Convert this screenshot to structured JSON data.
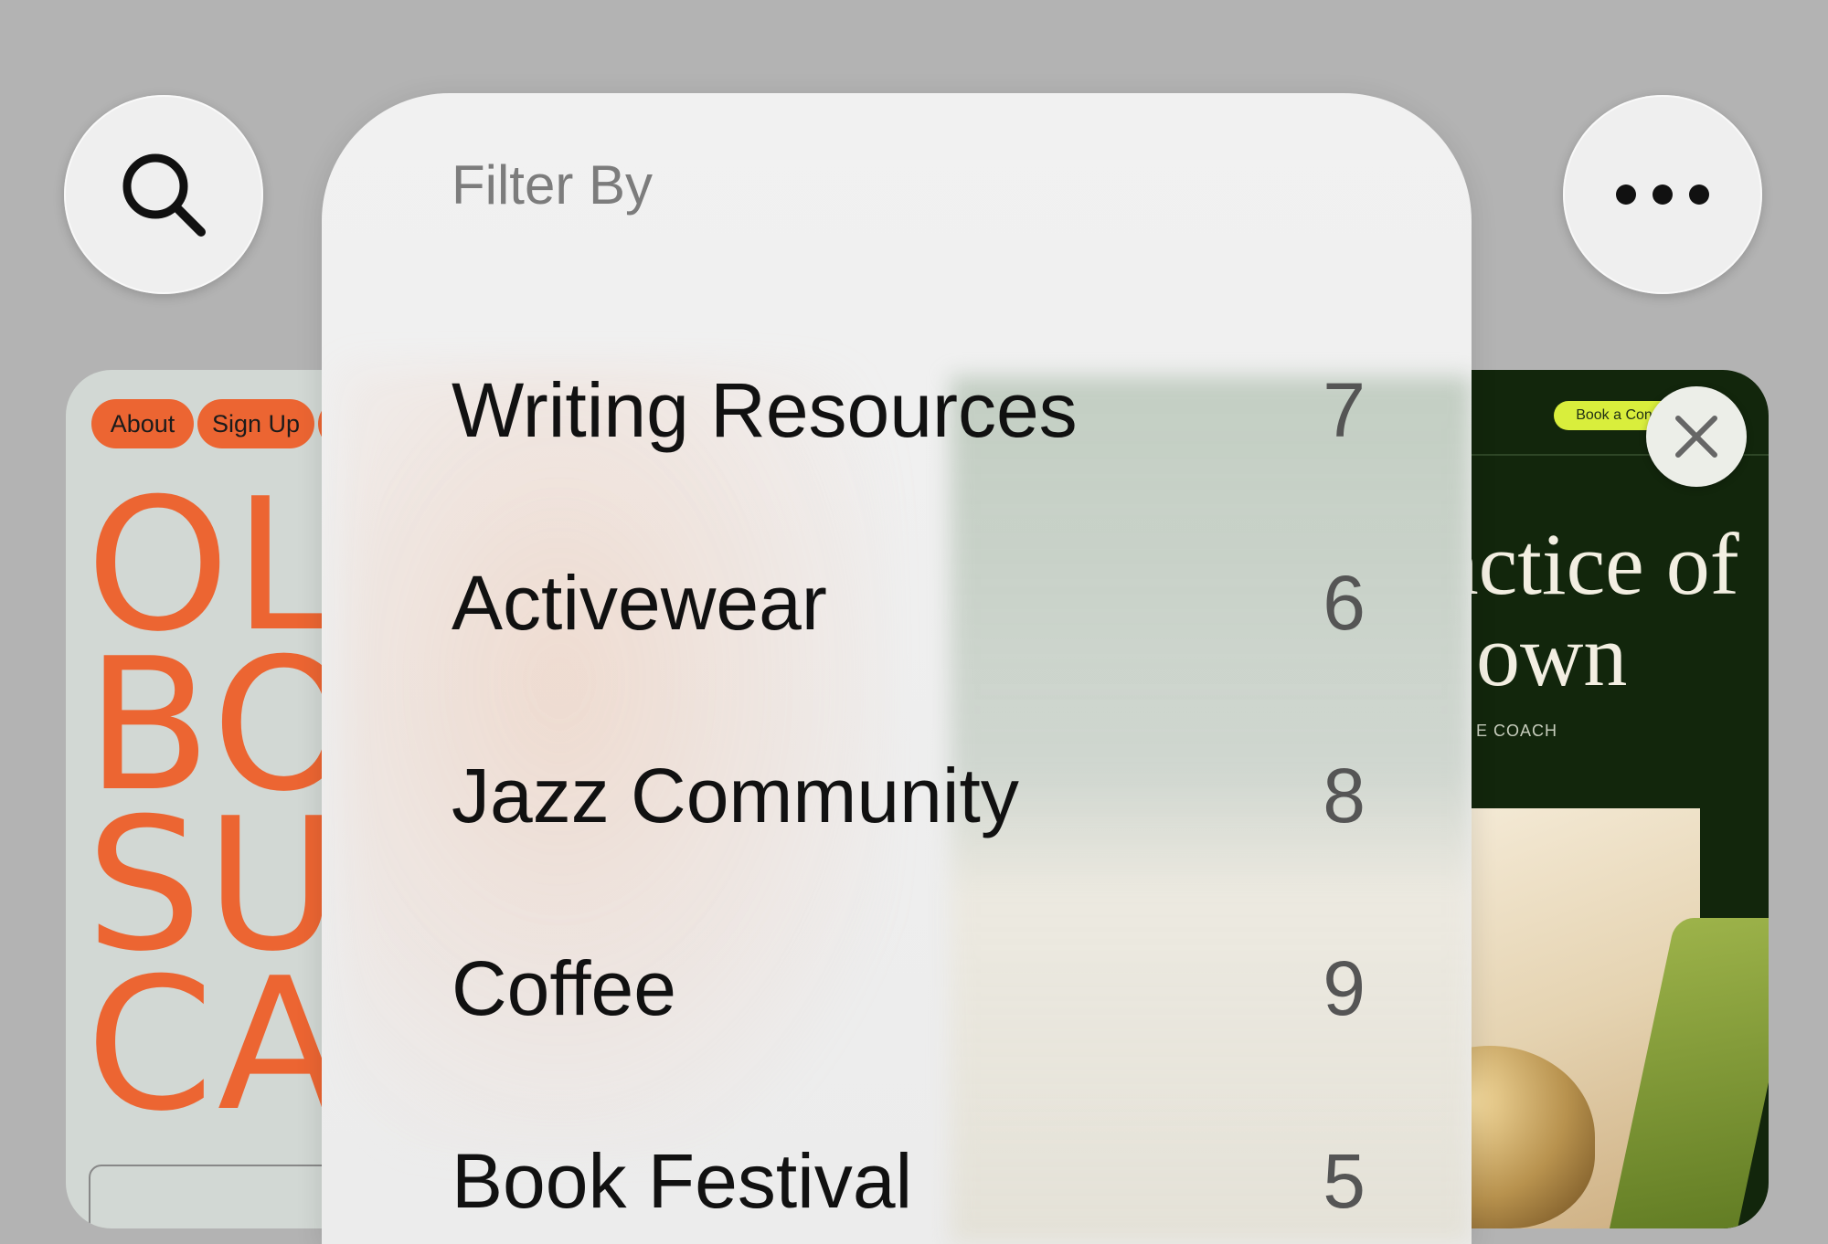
{
  "left_card": {
    "nav": [
      "About",
      "Sign Up"
    ],
    "headline_lines": [
      "OL",
      "BO",
      "SU",
      "CA"
    ]
  },
  "right_card": {
    "cta": "Book a Cons",
    "headline_lines": [
      "actice of",
      "own"
    ],
    "subline": "E  COACH"
  },
  "filter_panel": {
    "title": "Filter By",
    "items": [
      {
        "label": "Writing Resources",
        "count": "7"
      },
      {
        "label": "Activewear",
        "count": "6"
      },
      {
        "label": "Jazz Community",
        "count": "8"
      },
      {
        "label": "Coffee",
        "count": "9"
      },
      {
        "label": "Book Festival",
        "count": "5"
      }
    ]
  },
  "colors": {
    "background": "#b3b3b3",
    "accent_orange": "#ec6532",
    "dark_green": "#12260c",
    "lime": "#d9ee3c"
  },
  "icons": {
    "search": "search-icon",
    "more": "more-icon",
    "close": "close-icon"
  }
}
